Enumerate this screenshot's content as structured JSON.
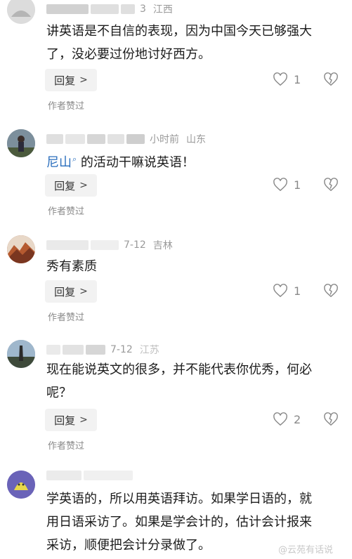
{
  "comments": [
    {
      "meta_suffix": "3",
      "location": "江西",
      "text": "讲英语是不自信的表现，因为中国今天已够强大了，没必要过份地讨好西方。",
      "likes": "1",
      "reply_label": "回复",
      "author_badge": "作者赞过",
      "avatar_color": "#cfcfcf"
    },
    {
      "meta_suffix": "小时前",
      "location": "山东",
      "mention": "尼山",
      "text": "的活动干嘛说英语！",
      "likes": "1",
      "reply_label": "回复",
      "author_badge": "作者赞过",
      "avatar_color": "#5f7280"
    },
    {
      "meta_suffix": "7-12",
      "location": "吉林",
      "text": "秀有素质",
      "likes": "1",
      "reply_label": "回复",
      "author_badge": "作者赞过",
      "avatar_color": "#a65a3a"
    },
    {
      "meta_suffix": "7-12",
      "location": "江苏",
      "text": "现在能说英文的很多，并不能代表你优秀，何必呢？",
      "likes": "2",
      "reply_label": "回复",
      "author_badge": "作者赞过",
      "avatar_color": "#6f8ea6"
    },
    {
      "meta_suffix": "",
      "location": "",
      "text": "学英语的，所以用英语拜访。如果学日语的，就用日语采访了。如果是学会计的，估计会计报来采访，顺便把会计分录做了。",
      "avatar_color": "#6a63b8"
    }
  ],
  "watermark": "@云苑有话说",
  "colors": {
    "mention": "#2a6ebd",
    "meta": "#9a9a9a"
  }
}
